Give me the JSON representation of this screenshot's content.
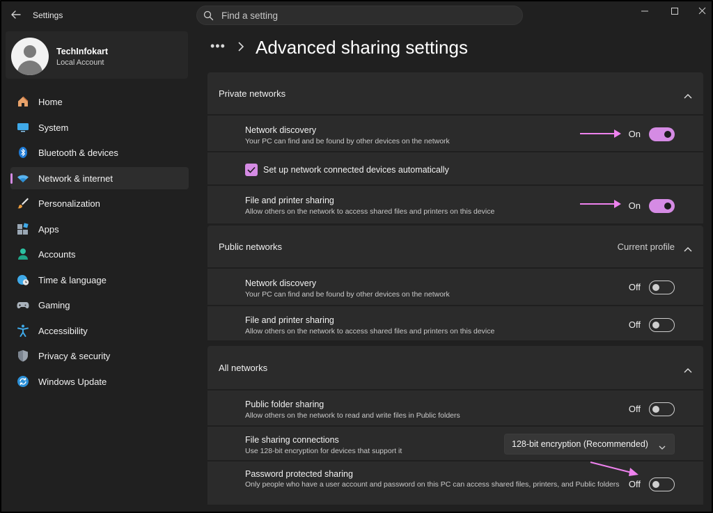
{
  "app": {
    "title": "Settings"
  },
  "search": {
    "placeholder": "Find a setting"
  },
  "profile": {
    "name": "TechInfokart",
    "account_type": "Local Account"
  },
  "sidebar": {
    "items": [
      {
        "label": "Home",
        "icon": "home-icon"
      },
      {
        "label": "System",
        "icon": "monitor-icon"
      },
      {
        "label": "Bluetooth & devices",
        "icon": "bluetooth-icon"
      },
      {
        "label": "Network & internet",
        "icon": "wifi-icon",
        "active": true
      },
      {
        "label": "Personalization",
        "icon": "brush-icon"
      },
      {
        "label": "Apps",
        "icon": "apps-icon"
      },
      {
        "label": "Accounts",
        "icon": "person-icon"
      },
      {
        "label": "Time & language",
        "icon": "globe-clock-icon"
      },
      {
        "label": "Gaming",
        "icon": "gamepad-icon"
      },
      {
        "label": "Accessibility",
        "icon": "accessibility-icon"
      },
      {
        "label": "Privacy & security",
        "icon": "shield-icon"
      },
      {
        "label": "Windows Update",
        "icon": "sync-icon"
      }
    ]
  },
  "breadcrumb": {
    "dots": "•••",
    "title": "Advanced sharing settings"
  },
  "sections": {
    "private": {
      "title": "Private networks",
      "network_discovery": {
        "title": "Network discovery",
        "desc": "Your PC can find and be found by other devices on the network",
        "state": "On"
      },
      "auto_setup": {
        "label": "Set up network connected devices automatically",
        "checked": true
      },
      "file_printer": {
        "title": "File and printer sharing",
        "desc": "Allow others on the network to access shared files and printers on this device",
        "state": "On"
      }
    },
    "public": {
      "title": "Public networks",
      "badge": "Current profile",
      "network_discovery": {
        "title": "Network discovery",
        "desc": "Your PC can find and be found by other devices on the network",
        "state": "Off"
      },
      "file_printer": {
        "title": "File and printer sharing",
        "desc": "Allow others on the network to access shared files and printers on this device",
        "state": "Off"
      }
    },
    "all": {
      "title": "All networks",
      "public_folder": {
        "title": "Public folder sharing",
        "desc": "Allow others on the network to read and write files in Public folders",
        "state": "Off"
      },
      "file_connections": {
        "title": "File sharing connections",
        "desc": "Use 128-bit encryption for devices that support it",
        "value": "128-bit encryption (Recommended)"
      },
      "password": {
        "title": "Password protected sharing",
        "desc": "Only people who have a user account and password on this PC can access shared files, printers, and Public folders",
        "state": "Off"
      }
    }
  },
  "colors": {
    "accent": "#d58be4",
    "annotation_arrow": "#ee82ee",
    "background": "#202020",
    "card": "#2b2b2b"
  }
}
